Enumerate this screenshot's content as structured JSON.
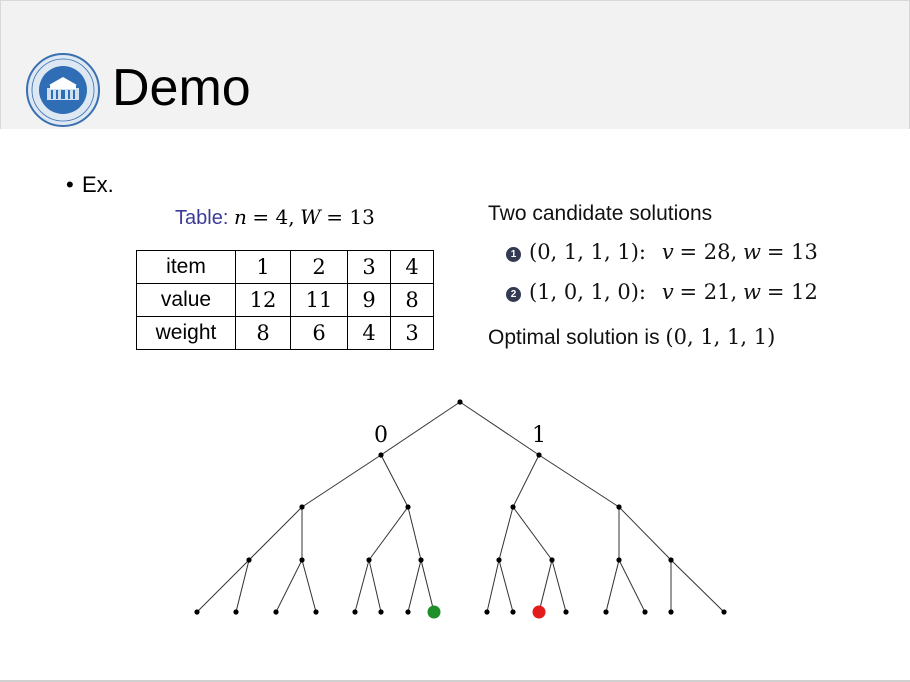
{
  "title": "Demo",
  "bullet": "Ex.",
  "table_caption": {
    "label": "Table:",
    "n_var": "n",
    "n_val": "= 4,",
    "w_var": "W",
    "w_val": "= 13"
  },
  "items_table": {
    "rows": [
      {
        "label": "item",
        "cells": [
          "1",
          "2",
          "3",
          "4"
        ]
      },
      {
        "label": "value",
        "cells": [
          "12",
          "11",
          "9",
          "8"
        ]
      },
      {
        "label": "weight",
        "cells": [
          "8",
          "6",
          "4",
          "3"
        ]
      }
    ]
  },
  "candidates": {
    "heading": "Two candidate solutions",
    "items": [
      {
        "num": "1",
        "vector": "(0, 1, 1, 1):",
        "v_label": "v",
        "v_val": "= 28,",
        "w_label": "w",
        "w_val": "= 13"
      },
      {
        "num": "2",
        "vector": "(1, 0, 1, 0):",
        "v_label": "v",
        "v_val": "= 21,",
        "w_label": "w",
        "w_val": "= 12"
      }
    ],
    "optimal_text": "Optimal solution is",
    "optimal_vector": "(0, 1, 1, 1)"
  },
  "tree": {
    "edge_labels": [
      "0",
      "1"
    ],
    "highlight_colors": {
      "optimal": "#1f8f2a",
      "other": "#e31b1b"
    }
  },
  "colors": {
    "header_bg": "#f2f2f2",
    "caption_blue": "#3b3b9a"
  }
}
